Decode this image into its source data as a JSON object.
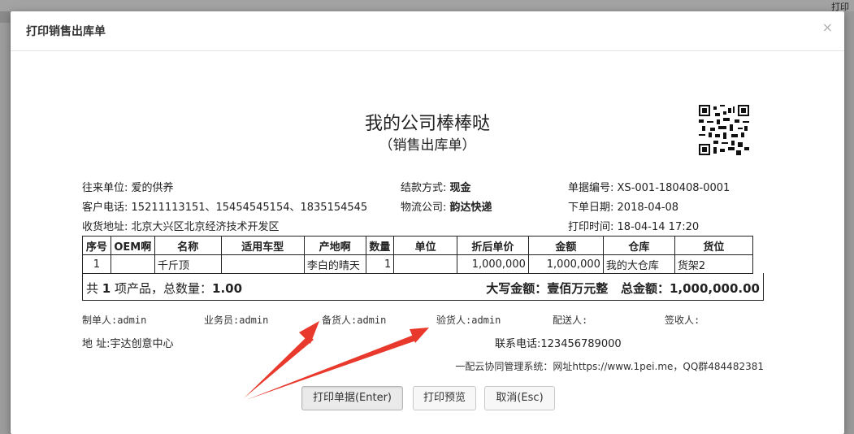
{
  "modal": {
    "title": "打印销售出库单",
    "close": "×"
  },
  "document": {
    "company": "我的公司棒棒哒",
    "subtitle": "（销售出库单）",
    "info": {
      "partner_label": "往来单位:",
      "partner": "爱的供养",
      "payment_label": "结款方式:",
      "payment": "现金",
      "docno_label": "单据编号:",
      "docno": "XS-001-180408-0001",
      "phone_label": "客户电话:",
      "phone": "15211113151、15454545154、1835154545",
      "logistics_label": "物流公司:",
      "logistics": "韵达快递",
      "orderdate_label": "下单日期:",
      "orderdate": "2018-04-08",
      "address_label": "收货地址:",
      "address": "北京大兴区北京经济技术开发区",
      "printtime_label": "打印时间:",
      "printtime": "18-04-14 17:20"
    },
    "table": {
      "headers": [
        "序号",
        "OEM啊",
        "名称",
        "适用车型",
        "产地啊",
        "数量",
        "单位",
        "折后单价",
        "金额",
        "仓库",
        "货位"
      ],
      "rows": [
        [
          "1",
          "",
          "千斤顶",
          "",
          "李白的晴天",
          "1",
          "",
          "1,000,000",
          "1,000,000",
          "我的大仓库",
          "货架2"
        ]
      ]
    },
    "summary": {
      "left_prefix": "共",
      "count": "1",
      "left_mid": "项产品，总数量：",
      "qty": "1.00",
      "capital_label": "大写金额：",
      "capital": "壹佰万元整",
      "total_label": "总金额：",
      "total": "1,000,000.00"
    },
    "staff": {
      "maker": "制单人:admin",
      "sales": "业务员:admin",
      "picker": "备货人:admin",
      "checker": "验货人:admin",
      "deliver": "配送人:",
      "receiver": "签收人:"
    },
    "addr_line": {
      "label": "地  址:",
      "value": "宇达创意中心"
    },
    "contact_line": {
      "label": "联系电话:",
      "value": "123456789000"
    },
    "footer": "一配云协同管理系统：网址https://www.1pei.me，QQ群484482381"
  },
  "buttons": {
    "print": "打印单据(Enter)",
    "preview": "打印预览",
    "cancel": "取消(Esc)"
  },
  "background": {
    "top_right": "打印"
  },
  "colors": {
    "arrow": "#e8392c"
  }
}
